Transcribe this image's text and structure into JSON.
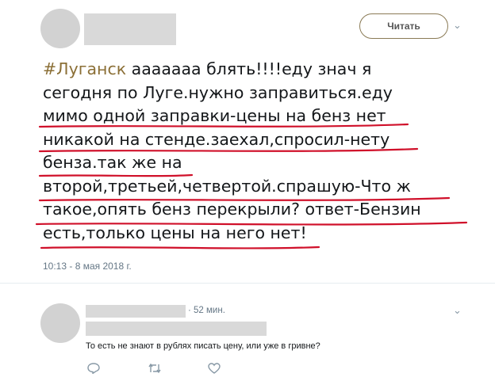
{
  "tweet": {
    "follow_label": "Читать",
    "lines": [
      {
        "hashtag": "#Луганск",
        "text": " ааааааа блять!!!!еду знач я"
      },
      {
        "text": "сегодня по Луге.нужно заправиться.еду"
      },
      {
        "text": "мимо одной заправки-цены на бенз нет"
      },
      {
        "text": "никакой на стенде.заехал,спросил-нету"
      },
      {
        "text": "бенза.так же на"
      },
      {
        "text": "второй,третьей,четвертой.спрашую-Что ж"
      },
      {
        "text": "такое,опять бенз перекрыли? ответ-Бензин"
      },
      {
        "text": "есть,только цены на него нет!"
      }
    ],
    "timestamp": "10:13 - 8 мая 2018 г.",
    "underline_color": "#d0102a"
  },
  "reply": {
    "time": "· 52 мин.",
    "text": "То есть не знают в рублях писать цену, или уже в гривне?"
  },
  "icons": {
    "chevron": "chevron-down-icon",
    "reply": "reply-icon",
    "retweet": "retweet-icon",
    "like": "heart-icon"
  },
  "colors": {
    "hashtag": "#8b6f36",
    "meta": "#657786"
  }
}
